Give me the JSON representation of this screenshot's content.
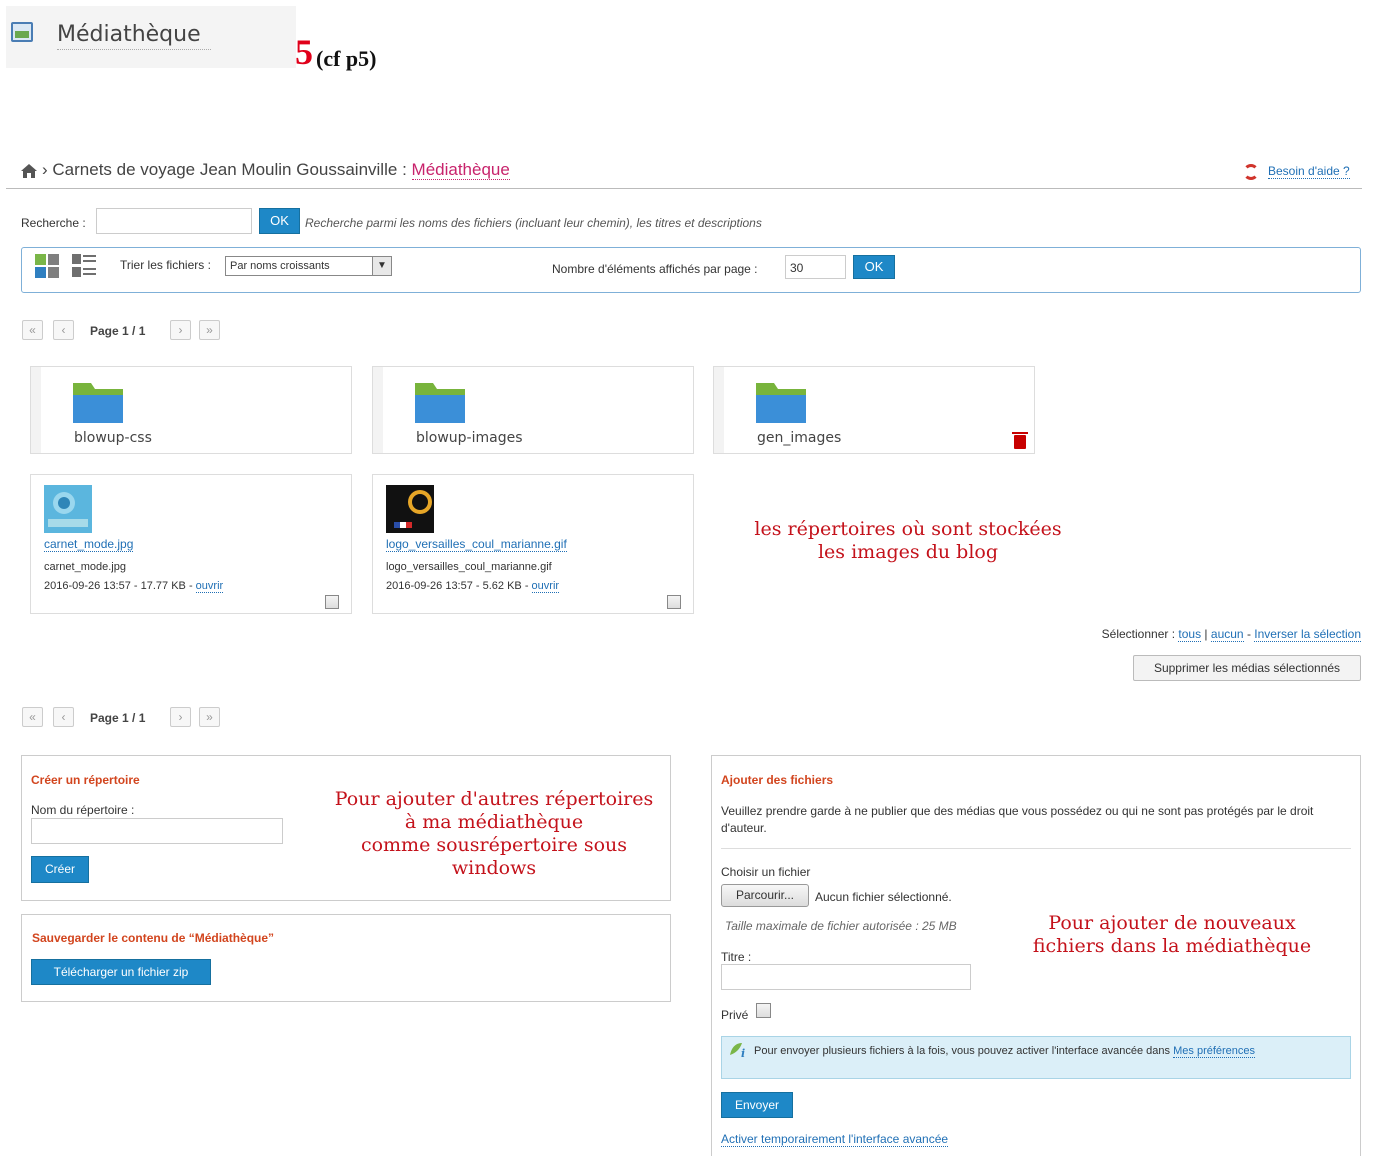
{
  "header": {
    "title": "Médiathèque",
    "step_number": "5",
    "step_ref": "(cf p5)"
  },
  "breadcrumb": {
    "separator": "›",
    "blog": "Carnets de voyage Jean Moulin Goussainville",
    "colon": ":",
    "current": "Médiathèque"
  },
  "help": {
    "label": "Besoin d'aide ?"
  },
  "search": {
    "label": "Recherche :",
    "value": "",
    "ok_label": "OK",
    "help_text": "Recherche parmi les noms des fichiers (incluant leur chemin), les titres et descriptions"
  },
  "filters": {
    "sort_label": "Trier les fichiers :",
    "sort_value": "Par noms croissants",
    "per_page_label": "Nombre d'éléments affichés par page :",
    "per_page_value": "30",
    "ok_label": "OK"
  },
  "pagination": {
    "first": "«",
    "prev": "‹",
    "label": "Page 1 / 1",
    "next": "›",
    "last": "»"
  },
  "folders": [
    {
      "name": "blowup-css",
      "deletable": false
    },
    {
      "name": "blowup-images",
      "deletable": false
    },
    {
      "name": "gen_images",
      "deletable": true
    }
  ],
  "files": [
    {
      "link": "carnet_mode.jpg",
      "name": "carnet_mode.jpg",
      "meta": "2016-09-26 13:57 - 17.77 KB - ",
      "open_label": "ouvrir"
    },
    {
      "link": "logo_versailles_coul_marianne.gif",
      "name": "logo_versailles_coul_marianne.gif",
      "meta": "2016-09-26 13:57 - 5.62 KB - ",
      "open_label": "ouvrir"
    }
  ],
  "annotations": {
    "folders_note": "les répertoires où sont stockées\nles images du blog",
    "create_dir_note": "Pour ajouter d'autres répertoires\nà ma médiathèque\ncomme sousrépertoire sous\nwindows",
    "add_files_note": "Pour ajouter de nouveaux\nfichiers dans la médiathèque"
  },
  "selection": {
    "label": "Sélectionner :",
    "all": "tous",
    "sep1": "|",
    "none": "aucun",
    "sep2": "-",
    "invert": "Inverser la sélection",
    "delete_label": "Supprimer les médias sélectionnés"
  },
  "create_dir": {
    "title": "Créer un répertoire",
    "label": "Nom du répertoire :",
    "value": "",
    "button": "Créer"
  },
  "backup": {
    "title": "Sauvegarder le contenu de “Médiathèque”",
    "button": "Télécharger un fichier zip"
  },
  "upload": {
    "title": "Ajouter des fichiers",
    "warning": "Veuillez prendre garde à ne publier que des médias que vous possédez ou qui ne sont pas protégés par le droit d'auteur.",
    "choose_label": "Choisir un fichier",
    "browse_button": "Parcourir...",
    "no_file": "Aucun fichier sélectionné.",
    "max_size": "Taille maximale de fichier autorisée : 25 MB",
    "title_label": "Titre :",
    "title_value": "",
    "private_label": "Privé",
    "info_text": "Pour envoyer plusieurs fichiers à la fois, vous pouvez activer l'interface avancée dans ",
    "info_link": "Mes préférences",
    "send_button": "Envoyer",
    "advanced_link": "Activer temporairement l'interface avancée"
  },
  "colors": {
    "accent_blue": "#1e88c7",
    "annotation_red": "#c4121b",
    "panel_title": "#d2451e",
    "breadcrumb_current": "#c8236c",
    "folder_blue": "#3b8fd8",
    "folder_green": "#78b43c"
  }
}
